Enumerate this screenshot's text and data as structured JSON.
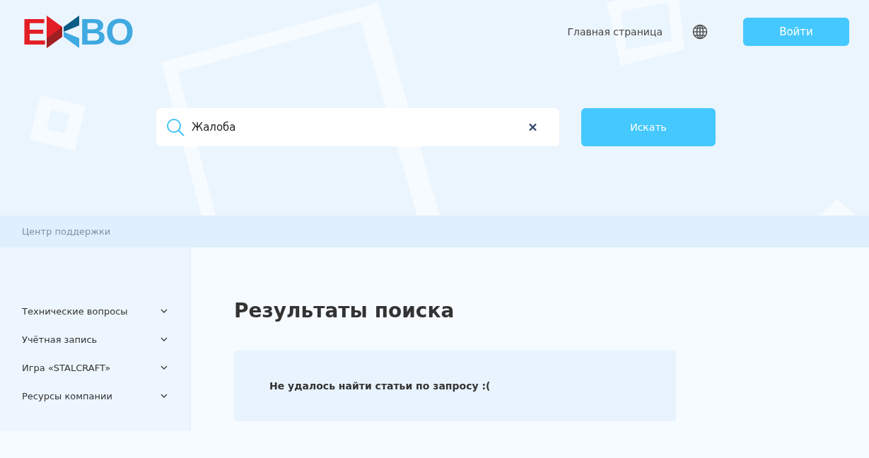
{
  "logo": {
    "left": "E",
    "right": "BO"
  },
  "nav": {
    "home_link": "Главная страница",
    "login_button": "Войти"
  },
  "search": {
    "value": "Жалоба",
    "button": "Искать"
  },
  "breadcrumb": "Центр поддержки",
  "sidebar": {
    "items": [
      {
        "label": "Технические вопросы",
        "expanded": false
      },
      {
        "label": "Учётная запись",
        "expanded": false
      },
      {
        "label": "Игра «STALCRAFT»",
        "expanded": false
      },
      {
        "label": "Ресурсы компании",
        "expanded": false
      }
    ]
  },
  "main": {
    "title": "Результаты поиска",
    "message": "Не удалось найти статьи по запросу :("
  }
}
